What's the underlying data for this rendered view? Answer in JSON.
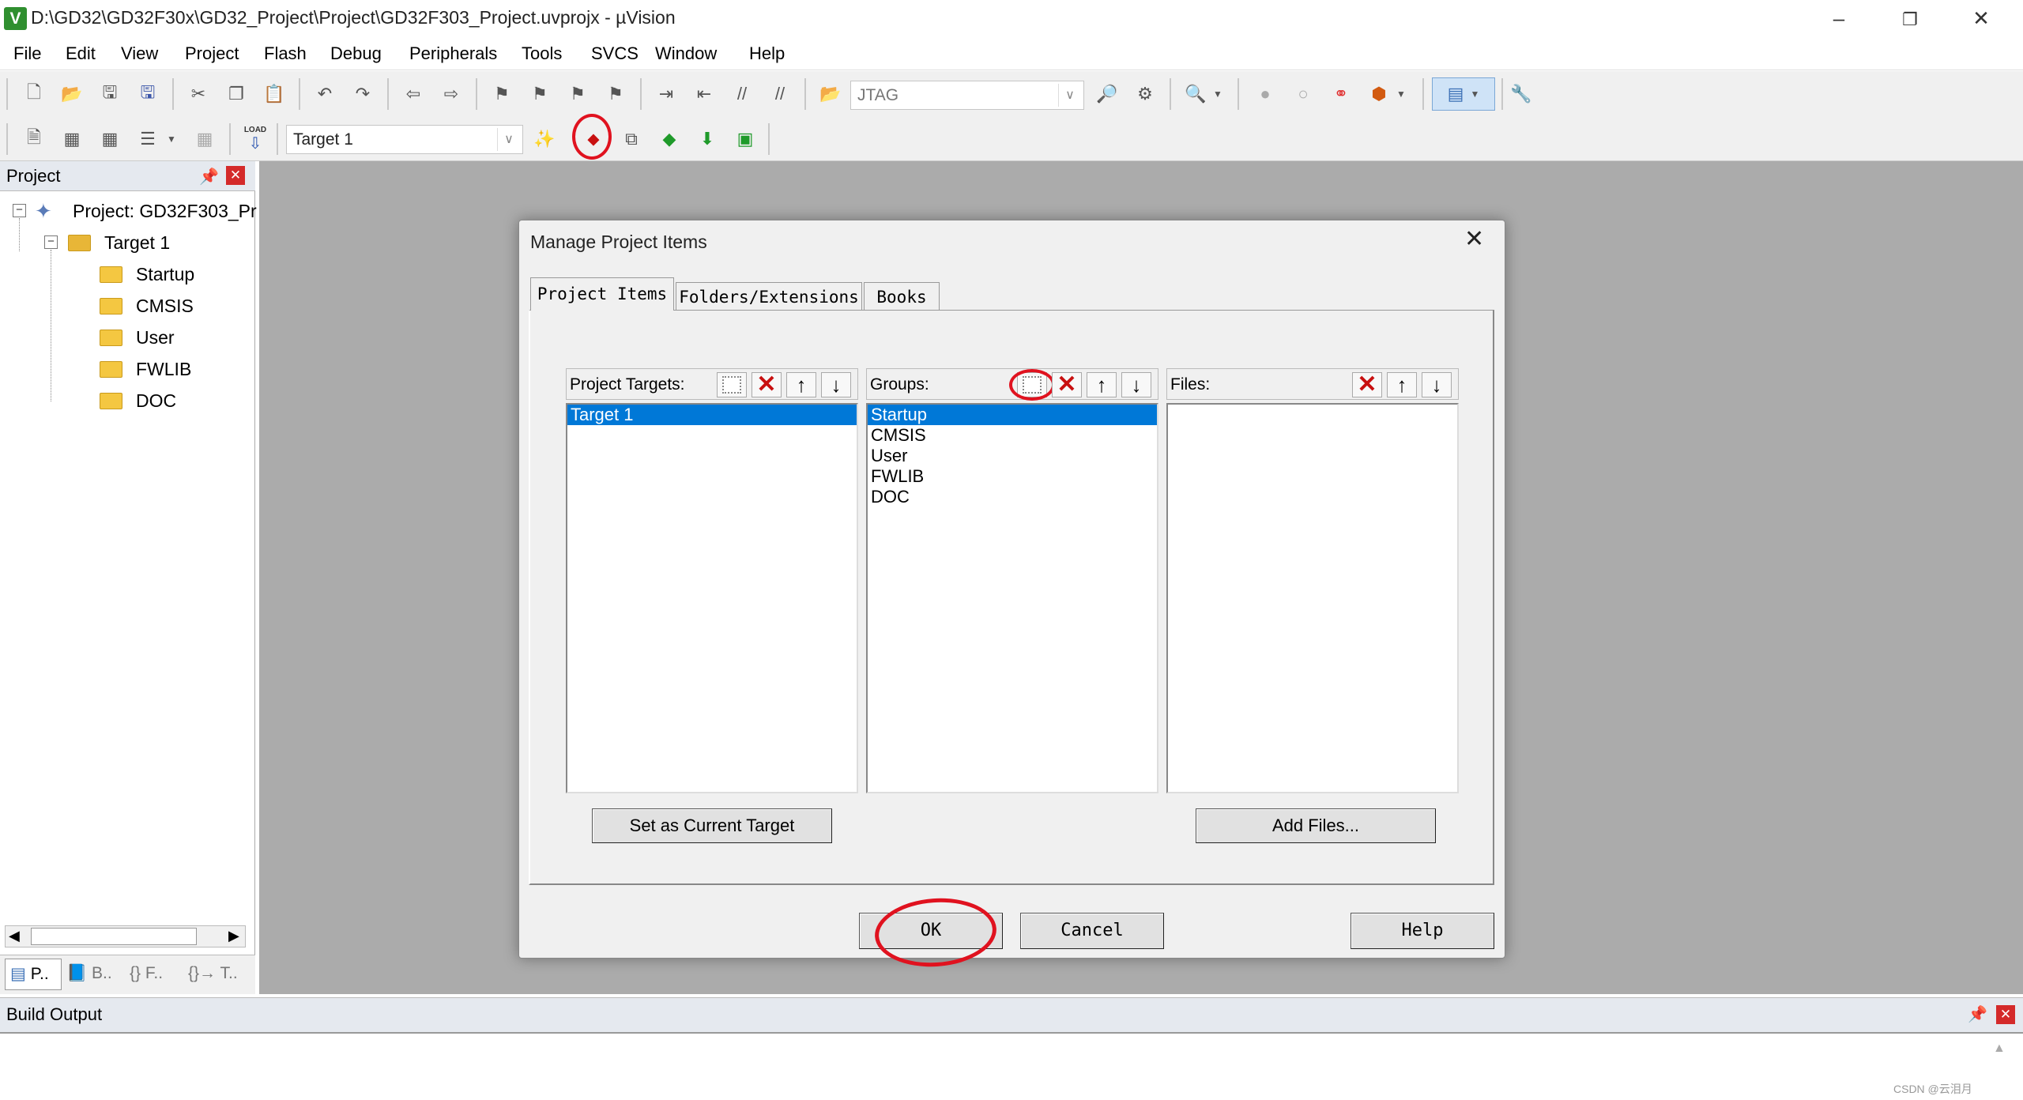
{
  "window": {
    "title": "D:\\GD32\\GD32F30x\\GD32_Project\\Project\\GD32F303_Project.uvprojx - µVision",
    "icon_label": "V",
    "controls": [
      "minimize-icon",
      "restore-icon",
      "close-icon"
    ]
  },
  "menu": [
    "File",
    "Edit",
    "View",
    "Project",
    "Flash",
    "Debug",
    "Peripherals",
    "Tools",
    "SVCS",
    "Window",
    "Help"
  ],
  "toolbar": {
    "debugger_combo": "JTAG",
    "target_combo": "Target 1",
    "load_label": "LOAD"
  },
  "project_panel": {
    "title": "Project",
    "tree": {
      "root": "Project: GD32F303_Pr",
      "target": "Target 1",
      "groups": [
        "Startup",
        "CMSIS",
        "User",
        "FWLIB",
        "DOC"
      ]
    },
    "tabs": [
      "P..",
      "B..",
      "{} F..",
      "{}→ T.."
    ]
  },
  "build_output": {
    "title": "Build Output"
  },
  "dialog": {
    "title": "Manage Project Items",
    "tabs": [
      "Project Items",
      "Folders/Extensions",
      "Books"
    ],
    "active_tab": "Project Items",
    "targets": {
      "label": "Project Targets:",
      "items": [
        "Target 1"
      ],
      "selected": "Target 1"
    },
    "groups": {
      "label": "Groups:",
      "items": [
        "Startup",
        "CMSIS",
        "User",
        "FWLIB",
        "DOC"
      ],
      "selected": "Startup"
    },
    "files": {
      "label": "Files:",
      "items": []
    },
    "buttons": {
      "set_current": "Set as Current Target",
      "add_files": "Add Files...",
      "ok": "OK",
      "cancel": "Cancel",
      "help": "Help"
    }
  },
  "watermark": "CSDN @云泪月",
  "colors": {
    "selection": "#0078d7",
    "annotation": "#e0121f",
    "workspace": "#ababab"
  }
}
